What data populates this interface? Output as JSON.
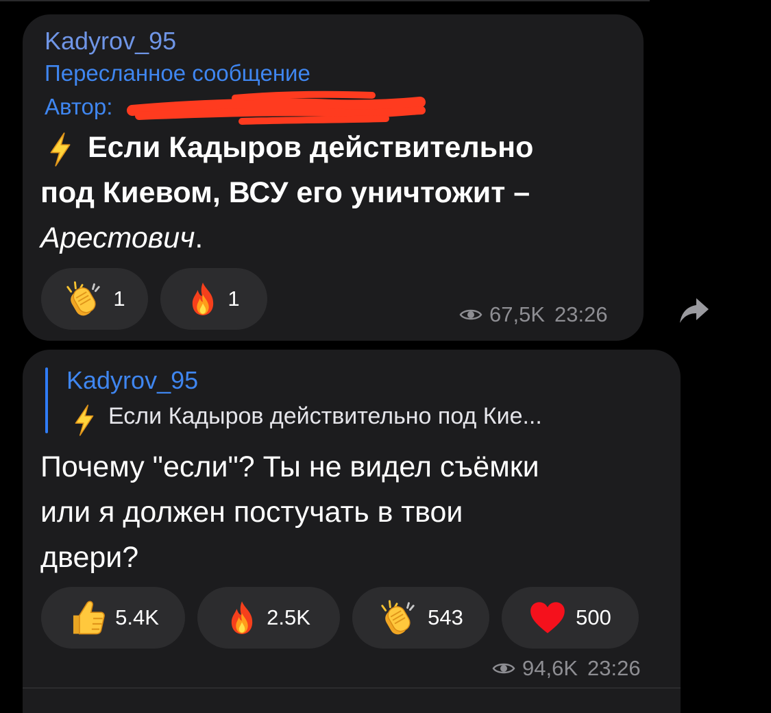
{
  "message1": {
    "sender": "Kadyrov_95",
    "forwarded_label": "Пересланное сообщение",
    "author_label": "Автор:",
    "text_line1": "Если Кадыров действительно",
    "text_line2": "под Киевом, ВСУ его уничтожит –",
    "text_line3": "Арестович",
    "text_line3_end": ".",
    "reactions": [
      {
        "icon": "clapping-hands-icon",
        "count": "1"
      },
      {
        "icon": "fire-icon",
        "count": "1"
      }
    ],
    "views": "67,5K",
    "time": "23:26"
  },
  "message2": {
    "reply_sender": "Kadyrov_95",
    "reply_preview": "Если Кадыров действительно под Кие...",
    "text_line1": "Почему \"если\"? Ты не видел съёмки",
    "text_line2": "или я должен постучать в твои",
    "text_line3": "двери?",
    "reactions": [
      {
        "icon": "thumbs-up-icon",
        "count": "5.4K"
      },
      {
        "icon": "fire-icon",
        "count": "2.5K"
      },
      {
        "icon": "clapping-hands-icon",
        "count": "543"
      },
      {
        "icon": "heart-icon",
        "count": "500"
      }
    ],
    "views": "94,6K",
    "time": "23:26"
  },
  "colors": {
    "background": "#000000",
    "bubble": "#1c1c1e",
    "reaction_pill": "#2c2c2e",
    "link_blue": "#3f86f0",
    "meta_gray": "#8e8e93",
    "redaction": "#ff3b1f"
  }
}
